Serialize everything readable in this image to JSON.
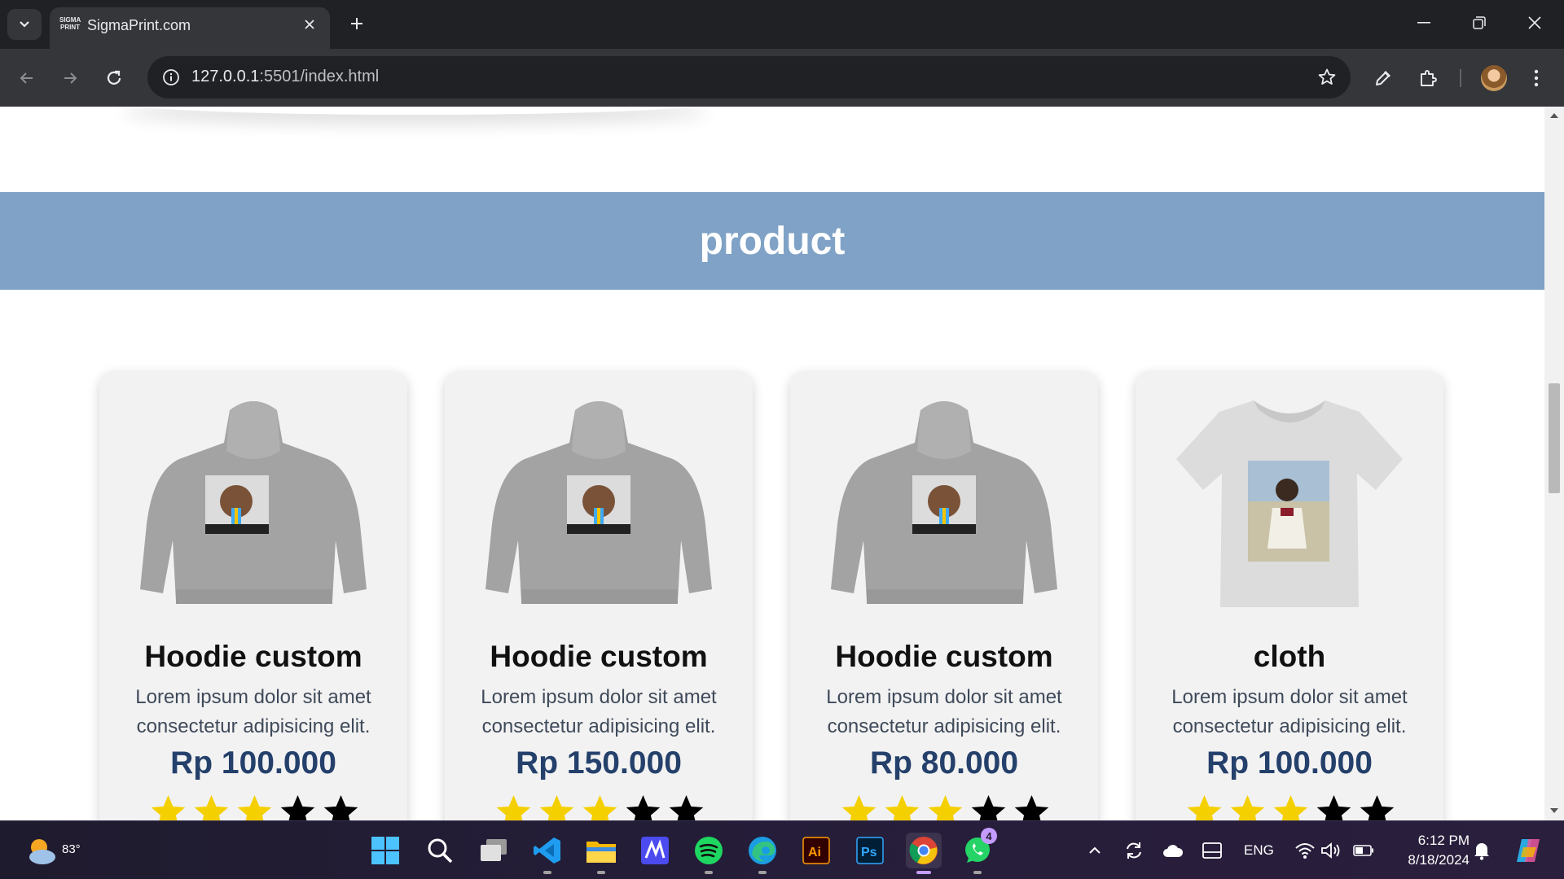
{
  "browser": {
    "tab_title": "SigmaPrint.com",
    "favicon_text": "SIGMA PRINT",
    "url_host": "127.0.0.1",
    "url_rest": ":5501/index.html"
  },
  "page": {
    "section_title": "product",
    "products": [
      {
        "name": "Hoodie custom",
        "description": "Lorem ipsum dolor sit amet consectetur adipisicing elit.",
        "price": "Rp 100.000",
        "rating": 3,
        "max_rating": 5,
        "image": "hoodie"
      },
      {
        "name": "Hoodie custom",
        "description": "Lorem ipsum dolor sit amet consectetur adipisicing elit.",
        "price": "Rp 150.000",
        "rating": 3,
        "max_rating": 5,
        "image": "hoodie"
      },
      {
        "name": "Hoodie custom",
        "description": "Lorem ipsum dolor sit amet consectetur adipisicing elit.",
        "price": "Rp 80.000",
        "rating": 3,
        "max_rating": 5,
        "image": "hoodie"
      },
      {
        "name": "cloth",
        "description": "Lorem ipsum dolor sit amet consectetur adipisicing elit.",
        "price": "Rp 100.000",
        "rating": 3,
        "max_rating": 5,
        "image": "tshirt"
      }
    ],
    "colors": {
      "banner": "#7fa2c6",
      "price": "#24406b",
      "star_filled": "#f5d000",
      "star_empty": "#000000"
    }
  },
  "taskbar": {
    "weather_temp": "83°",
    "apps": [
      "start",
      "search",
      "task-view",
      "vscode",
      "file-explorer",
      "app-m",
      "spotify",
      "edge",
      "illustrator",
      "photoshop",
      "chrome",
      "whatsapp"
    ],
    "whatsapp_badge": "4",
    "language": "ENG",
    "time": "6:12 PM",
    "date": "8/18/2024"
  }
}
